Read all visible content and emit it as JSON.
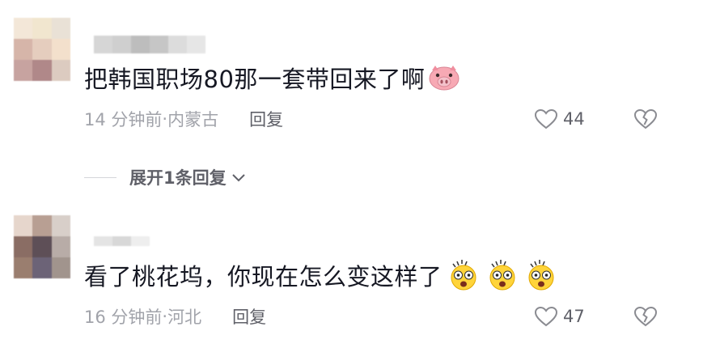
{
  "comments": [
    {
      "text": "把韩国职场80那一套带回来了啊",
      "emojis": [
        "pig-face-emoji"
      ],
      "time": "14 分钟前",
      "separator": " · ",
      "location": "内蒙古",
      "reply_label": "回复",
      "likes": "44",
      "avatar_colors": [
        "#f3e7d8",
        "#f1e6cf",
        "#e9e1d6",
        "#d6b5a9",
        "#e5cdbe",
        "#f3e0cc",
        "#c7a3a0",
        "#b08889",
        "#dccbc0"
      ],
      "username_colors": [
        "#d6d6d6",
        "#cfcfcf",
        "#bdbdbd",
        "#c6c6c6",
        "#dcdcdc",
        "#e6e6e6"
      ]
    },
    {
      "text": "看了桃花坞，你现在怎么变这样了",
      "emojis": [
        "shocked-face-emoji",
        "shocked-face-emoji",
        "shocked-face-emoji"
      ],
      "time": "16 分钟前",
      "separator": " · ",
      "location": "河北",
      "reply_label": "回复",
      "likes": "47",
      "avatar_colors": [
        "#e6d6cc",
        "#b89f93",
        "#d8cfc9",
        "#8a6d64",
        "#5e4f57",
        "#b8aca7",
        "#9a7e6f",
        "#6c6377",
        "#a1948d"
      ],
      "username_colors": [
        "#e4e4e4",
        "#d8d8d8",
        "#eeeeee"
      ]
    }
  ],
  "expand_replies": {
    "label": "展开1条回复"
  },
  "colors": {
    "text": "#161823",
    "meta": "#a1a3aa",
    "action": "#5f6068"
  }
}
